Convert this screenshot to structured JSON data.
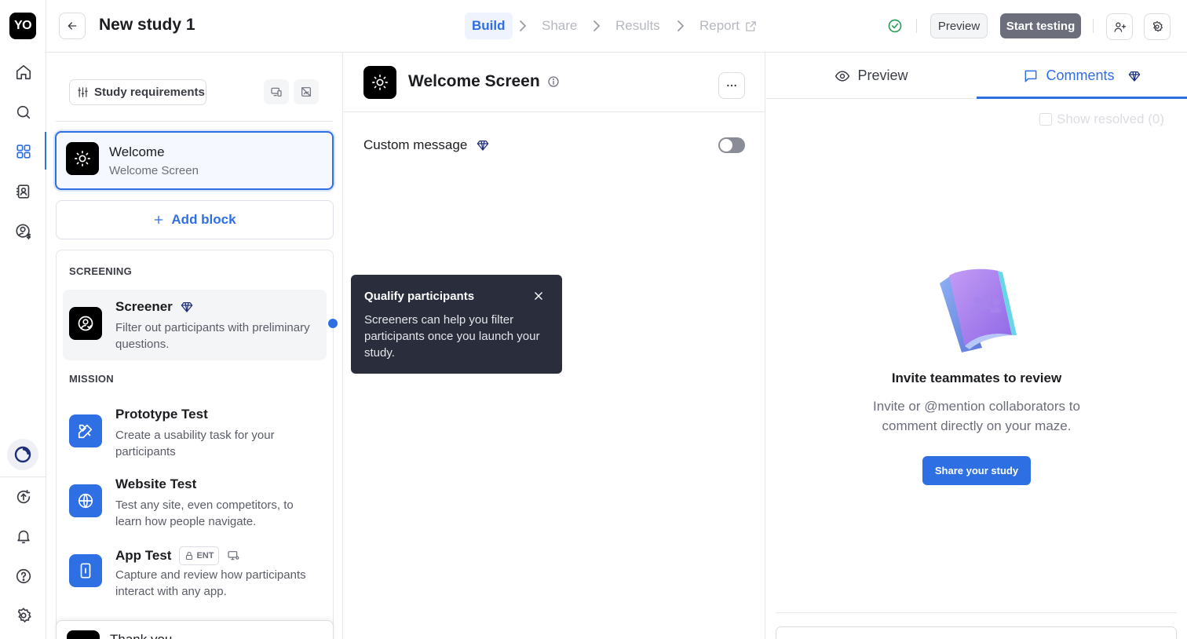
{
  "rail": {
    "logo_text": "YO",
    "icons": [
      "home-icon",
      "search-icon",
      "grid-icon",
      "contacts-icon",
      "user-dollar-icon",
      "plan-icon",
      "upload-icon",
      "bell-icon",
      "help-icon",
      "gear-icon"
    ]
  },
  "header": {
    "study_title": "New study 1",
    "steps": [
      {
        "label": "Build",
        "active": true
      },
      {
        "label": "Share",
        "active": false
      },
      {
        "label": "Results",
        "active": false
      },
      {
        "label": "Report",
        "active": false
      }
    ],
    "preview_label": "Preview",
    "start_label": "Start testing"
  },
  "blocks": {
    "requirements_label": "Study requirements",
    "welcome_title": "Welcome",
    "welcome_subtitle": "Welcome Screen",
    "add_block_label": "Add block",
    "sections": [
      {
        "label": "SCREENING"
      },
      {
        "label": "MISSION"
      }
    ],
    "items": [
      {
        "title": "Screener",
        "desc": "Filter out participants with preliminary questions."
      },
      {
        "title": "Prototype Test",
        "desc": "Create a usability task for your participants"
      },
      {
        "title": "Website Test",
        "desc": "Test any site, even competitors, to learn how people navigate."
      },
      {
        "title": "App Test",
        "desc": "Capture and review how participants interact with any app.",
        "badge": "ENT"
      }
    ],
    "thank_you_title": "Thank you"
  },
  "editor": {
    "title": "Welcome Screen",
    "custom_message_label": "Custom message",
    "custom_message_enabled": false
  },
  "tooltip": {
    "title": "Qualify participants",
    "body": "Screeners can help you filter participants once you launch your study."
  },
  "right_panel": {
    "tabs": [
      {
        "label": "Preview",
        "active": false
      },
      {
        "label": "Comments",
        "active": true
      }
    ],
    "show_resolved_label": "Show resolved (0)",
    "invite_title": "Invite teammates to review",
    "invite_text": "Invite or @mention collaborators to comment directly on your maze.",
    "share_button": "Share your study"
  },
  "colors": {
    "accent": "#2f6fe4",
    "tooltip_bg": "#2a2d3b",
    "success": "#2e9d5a"
  }
}
